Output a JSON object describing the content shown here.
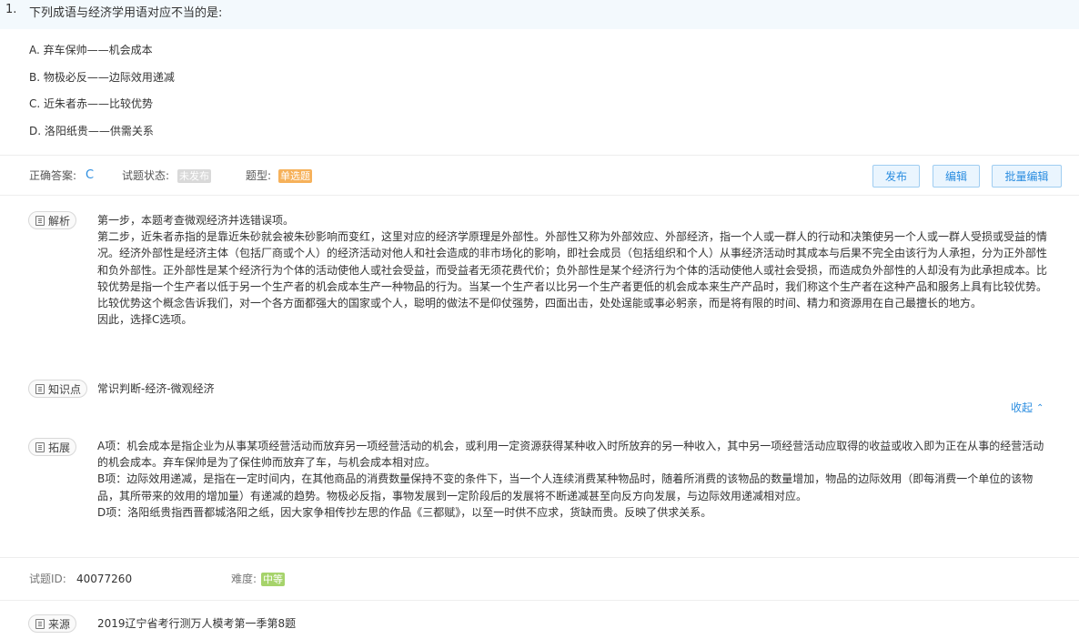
{
  "question": {
    "number": "1.",
    "stem": "下列成语与经济学用语对应不当的是:",
    "options": [
      {
        "key": "A",
        "label": "A.  弃车保帅——机会成本"
      },
      {
        "key": "B",
        "label": "B.  物极必反——边际效用递减"
      },
      {
        "key": "C",
        "label": "C.  近朱者赤——比较优势"
      },
      {
        "key": "D",
        "label": "D.  洛阳纸贵——供需关系"
      }
    ]
  },
  "meta": {
    "answer_label": "正确答案:",
    "answer_value": "C",
    "status_label": "试题状态:",
    "status_value": "未发布",
    "type_label": "题型:",
    "type_value": "单选题"
  },
  "actions": {
    "publish": "发布",
    "edit": "编辑",
    "batch_edit": "批量编辑"
  },
  "analysis": {
    "tag": "解析",
    "paragraphs": [
      "第一步，本题考查微观经济并选错误项。",
      "第二步，近朱者赤指的是靠近朱砂就会被朱砂影响而变红，这里对应的经济学原理是外部性。外部性又称为外部效应、外部经济，指一个人或一群人的行动和决策使另一个人或一群人受损或受益的情况。经济外部性是经济主体（包括厂商或个人）的经济活动对他人和社会造成的非市场化的影响，即社会成员（包括组织和个人）从事经济活动时其成本与后果不完全由该行为人承担，分为正外部性和负外部性。正外部性是某个经济行为个体的活动使他人或社会受益，而受益者无须花费代价；负外部性是某个经济行为个体的活动使他人或社会受损，而造成负外部性的人却没有为此承担成本。比较优势是指一个生产者以低于另一个生产者的机会成本生产一种物品的行为。当某一个生产者以比另一个生产者更低的机会成本来生产产品时，我们称这个生产者在这种产品和服务上具有比较优势。比较优势这个概念告诉我们，对一个各方面都强大的国家或个人，聪明的做法不是仰仗强势，四面出击，处处逞能或事必躬亲，而是将有限的时间、精力和资源用在自己最擅长的地方。",
      "因此，选择C选项。"
    ]
  },
  "knowledge": {
    "tag": "知识点",
    "value": "常识判断-经济-微观经济"
  },
  "collapse": {
    "label": "收起",
    "icon": "chevron-up-icon"
  },
  "extension": {
    "tag": "拓展",
    "paragraphs": [
      "A项：机会成本是指企业为从事某项经营活动而放弃另一项经营活动的机会，或利用一定资源获得某种收入时所放弃的另一种收入，其中另一项经营活动应取得的收益或收入即为正在从事的经营活动的机会成本。弃车保帅是为了保住帅而放弃了车，与机会成本相对应。",
      "B项：边际效用递减，是指在一定时间内，在其他商品的消费数量保持不变的条件下，当一个人连续消费某种物品时，随着所消费的该物品的数量增加，物品的边际效用（即每消费一个单位的该物品，其所带来的效用的增加量）有递减的趋势。物极必反指，事物发展到一定阶段后的发展将不断递减甚至向反方向发展，与边际效用递减相对应。",
      "D项：洛阳纸贵指西晋都城洛阳之纸，因大家争相传抄左思的作品《三都赋》，以至一时供不应求，货缺而贵。反映了供求关系。"
    ]
  },
  "footer": {
    "id_label": "试题ID:",
    "id_value": "40077260",
    "difficulty_label": "难度:",
    "difficulty_value": "中等"
  },
  "source": {
    "tag": "来源",
    "value": "2019辽宁省考行测万人模考第一季第8题"
  },
  "colors": {
    "accent": "#2b8de0",
    "header_bg": "#f3f9fd",
    "status_badge": "#d9d9d9",
    "type_badge": "#f6b15a",
    "difficulty_badge": "#a6d36b"
  }
}
